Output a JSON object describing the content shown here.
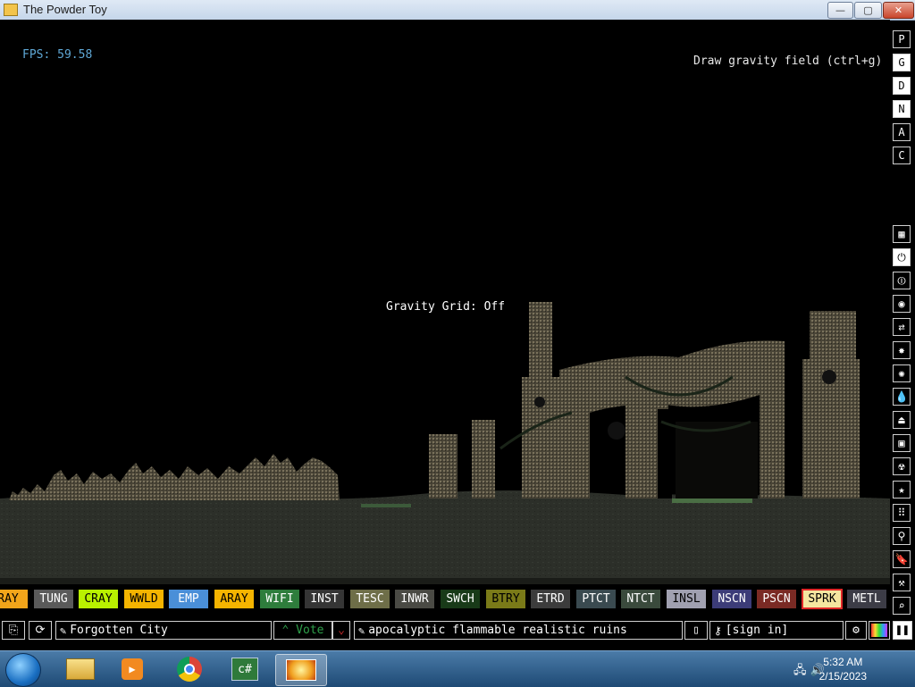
{
  "window": {
    "title": "The Powder Toy",
    "minimize": "—",
    "maximize": "▢",
    "close": "✕"
  },
  "sim": {
    "fps": "FPS: 59.58",
    "hint": "Draw gravity field (ctrl+g)",
    "toast": "Gravity Grid: Off"
  },
  "right_tools_top": [
    {
      "label": "P",
      "active": false
    },
    {
      "label": "G",
      "active": true
    },
    {
      "label": "D",
      "active": true
    },
    {
      "label": "N",
      "active": true
    },
    {
      "label": "A",
      "active": false
    },
    {
      "label": "C",
      "active": false
    }
  ],
  "right_tools_categories": [
    "walls-icon",
    "electronics-icon",
    "powered-icon",
    "sensors-icon",
    "force-icon",
    "explosives-icon",
    "gases-icon",
    "liquids-icon",
    "powders-icon",
    "solids-icon",
    "radioactive-icon",
    "special-icon",
    "game-of-life-icon",
    "tools-icon",
    "favorites-icon",
    "decoration-icon",
    "search-icon"
  ],
  "elements": [
    {
      "name": "RAY",
      "bg": "#f2a51a",
      "fg": "#000"
    },
    {
      "name": "TUNG",
      "bg": "#5a5a5a",
      "fg": "#fff"
    },
    {
      "name": "CRAY",
      "bg": "#b9f100",
      "fg": "#000"
    },
    {
      "name": "WWLD",
      "bg": "#f5b400",
      "fg": "#000"
    },
    {
      "name": "EMP",
      "bg": "#4a8fd8",
      "fg": "#fff"
    },
    {
      "name": "ARAY",
      "bg": "#f5b400",
      "fg": "#000"
    },
    {
      "name": "WIFI",
      "bg": "#2e7d3c",
      "fg": "#fff"
    },
    {
      "name": "INST",
      "bg": "#353535",
      "fg": "#fff"
    },
    {
      "name": "TESC",
      "bg": "#6e6e48",
      "fg": "#fff"
    },
    {
      "name": "INWR",
      "bg": "#4a4a44",
      "fg": "#fff"
    },
    {
      "name": "SWCH",
      "bg": "#183a18",
      "fg": "#fff"
    },
    {
      "name": "BTRY",
      "bg": "#7a7a18",
      "fg": "#000"
    },
    {
      "name": "ETRD",
      "bg": "#3c3c3c",
      "fg": "#fff"
    },
    {
      "name": "PTCT",
      "bg": "#3a4a50",
      "fg": "#fff"
    },
    {
      "name": "NTCT",
      "bg": "#3a4a3c",
      "fg": "#fff"
    },
    {
      "name": "INSL",
      "bg": "#a0a0b0",
      "fg": "#000"
    },
    {
      "name": "NSCN",
      "bg": "#3c3c78",
      "fg": "#fff"
    },
    {
      "name": "PSCN",
      "bg": "#7a2a24",
      "fg": "#fff"
    },
    {
      "name": "SPRK",
      "bg": "#f5e6a0",
      "fg": "#000",
      "selected": true
    },
    {
      "name": "METL",
      "bg": "#3c3c46",
      "fg": "#fff"
    }
  ],
  "bottom": {
    "save_name": "Forgotten City",
    "vote_label": "Vote",
    "tags": "apocalyptic flammable realistic ruins",
    "sign_in": "[sign in]"
  },
  "taskbar": {
    "time": "5:32 AM",
    "date": "2/15/2023",
    "csharp_label": "c#"
  }
}
